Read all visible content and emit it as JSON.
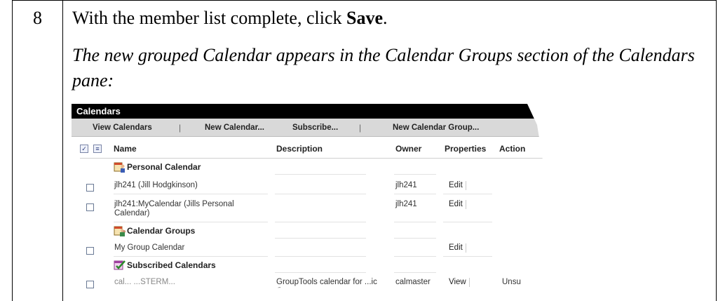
{
  "step": {
    "number": "8",
    "instruction_prefix": "With the member list complete, click ",
    "instruction_bold": "Save",
    "instruction_suffix": ".",
    "result_text": "The new grouped Calendar appears in the Calendar Groups section of the Calendars pane:"
  },
  "screenshot": {
    "title": "Calendars",
    "toolbar": {
      "items": [
        "View Calendars",
        "New Calendar...",
        "Subscribe...",
        "New Calendar Group..."
      ],
      "separator": "|"
    },
    "columns": {
      "name": "Name",
      "description": "Description",
      "owner": "Owner",
      "properties": "Properties",
      "action": "Action"
    },
    "sections": {
      "personal": "Personal Calendar",
      "groups": "Calendar Groups",
      "subscribed": "Subscribed Calendars"
    },
    "rows": [
      {
        "name": "jlh241 (Jill Hodgkinson)",
        "description": "",
        "owner": "jlh241",
        "properties": "Edit",
        "action": ""
      },
      {
        "name": "jlh241:MyCalendar (Jills Personal Calendar)",
        "description": "",
        "owner": "jlh241",
        "properties": "Edit",
        "action": ""
      },
      {
        "name": "My Group Calendar",
        "description": "",
        "owner": "",
        "properties": "Edit",
        "action": ""
      },
      {
        "name": "cal... ...STERM...",
        "description": "GroupTools calendar for ...ic Group",
        "owner": "calmaster",
        "properties": "View",
        "action": "Unsu"
      }
    ],
    "header_icons": [
      "check-all-icon",
      "details-icon"
    ],
    "colors": {
      "title_bar": "#000000",
      "toolbar": "#d9d9d9"
    }
  }
}
